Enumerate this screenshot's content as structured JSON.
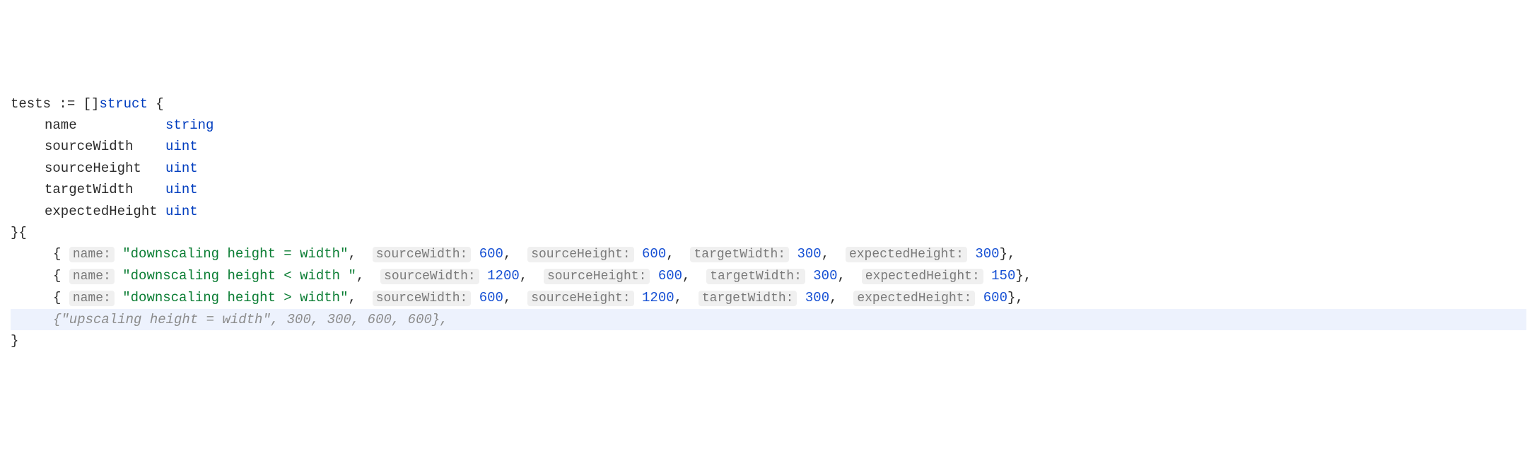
{
  "code": {
    "line1": {
      "tests": "tests",
      "decl": ":=",
      "slice": "[]",
      "struct": "struct",
      "brace": "{"
    },
    "fields": {
      "name": {
        "name": "name",
        "type": "string"
      },
      "sourceWidth": {
        "name": "sourceWidth",
        "type": "uint"
      },
      "sourceHeight": {
        "name": "sourceHeight",
        "type": "uint"
      },
      "targetWidth": {
        "name": "targetWidth",
        "type": "uint"
      },
      "expectedHeight": {
        "name": "expectedHeight",
        "type": "uint"
      }
    },
    "middleBraces": "}{",
    "entries": [
      {
        "nameHint": "name:",
        "nameVal": "\"downscaling height = width\"",
        "swHint": "sourceWidth:",
        "swVal": "600",
        "shHint": "sourceHeight:",
        "shVal": "600",
        "twHint": "targetWidth:",
        "twVal": "300",
        "ehHint": "expectedHeight:",
        "ehVal": "300"
      },
      {
        "nameHint": "name:",
        "nameVal": "\"downscaling height < width \"",
        "swHint": "sourceWidth:",
        "swVal": "1200",
        "shHint": "sourceHeight:",
        "shVal": "600",
        "twHint": "targetWidth:",
        "twVal": "300",
        "ehHint": "expectedHeight:",
        "ehVal": "150"
      },
      {
        "nameHint": "name:",
        "nameVal": "\"downscaling height > width\"",
        "swHint": "sourceWidth:",
        "swVal": "600",
        "shHint": "sourceHeight:",
        "shVal": "1200",
        "twHint": "targetWidth:",
        "twVal": "300",
        "ehHint": "expectedHeight:",
        "ehVal": "600"
      }
    ],
    "commentLine": "{\"upscaling height = width\", 300, 300, 600, 600},",
    "closeBrace": "}"
  }
}
